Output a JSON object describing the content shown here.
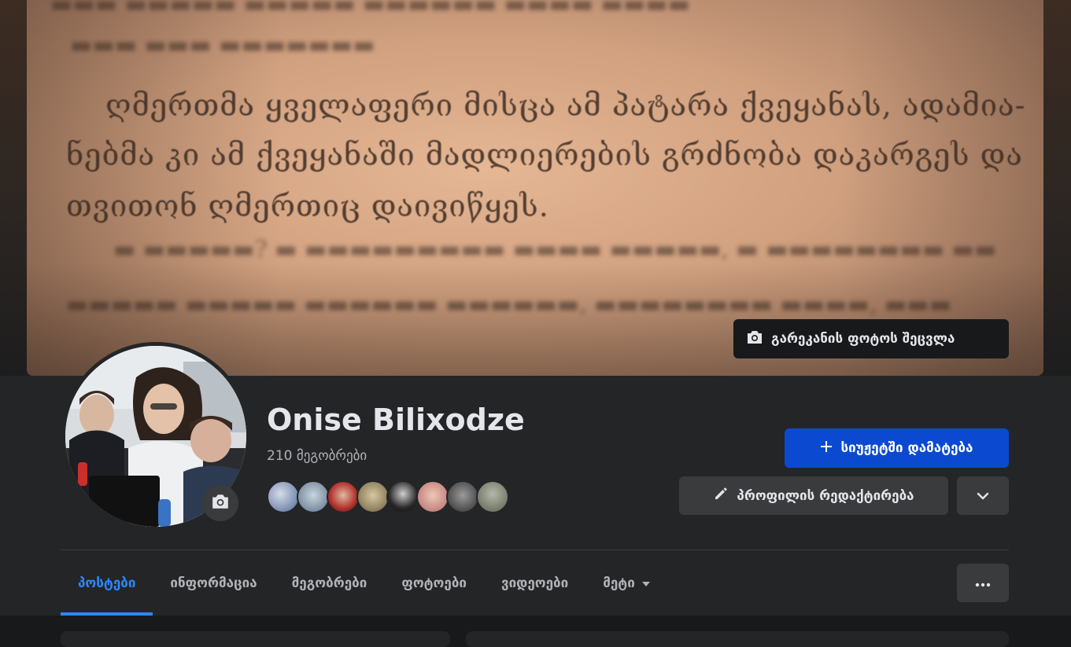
{
  "cover": {
    "text_lines": [
      "ღმერთმა ყველაფერი მისცა ამ პატარა ქვეყანას, ადამია-",
      "ნებმა კი ამ ქვეყანაში მადლიერების გრძნობა დაკარგეს და",
      "თვითონ ღმერთიც დაივიწყეს."
    ],
    "change_cover_label": "გარეკანის ფოტოს შეცვლა"
  },
  "profile": {
    "name": "Onise Bilixodze",
    "friends_count": "210 მეგობრები"
  },
  "actions": {
    "add_story_label": "სიუჟეტში დამატება",
    "edit_profile_label": "პროფილის რედაქტირება"
  },
  "tabs": [
    {
      "label": "პოსტები",
      "active": true
    },
    {
      "label": "ინფორმაცია",
      "active": false
    },
    {
      "label": "მეგობრები",
      "active": false
    },
    {
      "label": "ფოტოები",
      "active": false
    },
    {
      "label": "ვიდეოები",
      "active": false
    },
    {
      "label": "მეტი",
      "active": false
    }
  ],
  "colors": {
    "accent": "#2d88ff",
    "primary_button": "#0b4ad0",
    "surface": "#242526",
    "background": "#18191a"
  }
}
